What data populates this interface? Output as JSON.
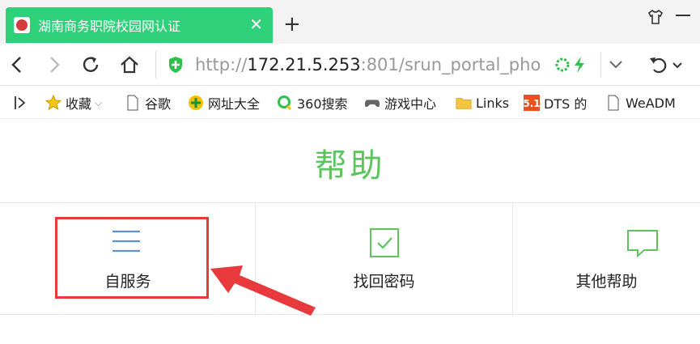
{
  "browser": {
    "tab": {
      "title": "湖南商务职院校园网认证"
    },
    "newtab_label": "+",
    "url": {
      "scheme": "http://",
      "host": "172.21.5.253",
      "rest": ":801/srun_portal_pho"
    },
    "bookmarks": [
      {
        "label": "收藏",
        "icon": "star-icon"
      },
      {
        "label": "谷歌",
        "icon": "page-icon"
      },
      {
        "label": "网址大全",
        "icon": "plus-circle-icon"
      },
      {
        "label": "360搜索",
        "icon": "search-ring-icon"
      },
      {
        "label": "游戏中心",
        "icon": "gamepad-icon"
      },
      {
        "label": "Links",
        "icon": "folder-icon"
      },
      {
        "label": "DTS 的",
        "icon": "five-one-icon"
      },
      {
        "label": "WeADM",
        "icon": "page-icon"
      }
    ]
  },
  "help": {
    "title": "帮助",
    "items": [
      {
        "label": "自服务",
        "icon": "menu-icon"
      },
      {
        "label": "找回密码",
        "icon": "checkbox-icon"
      },
      {
        "label": "其他帮助",
        "icon": "chat-icon"
      }
    ]
  },
  "colors": {
    "tab": "#2fd07a",
    "accent_green": "#5cc45c",
    "highlight_red": "#e8393c",
    "icon_blue": "#5b8fd6"
  }
}
